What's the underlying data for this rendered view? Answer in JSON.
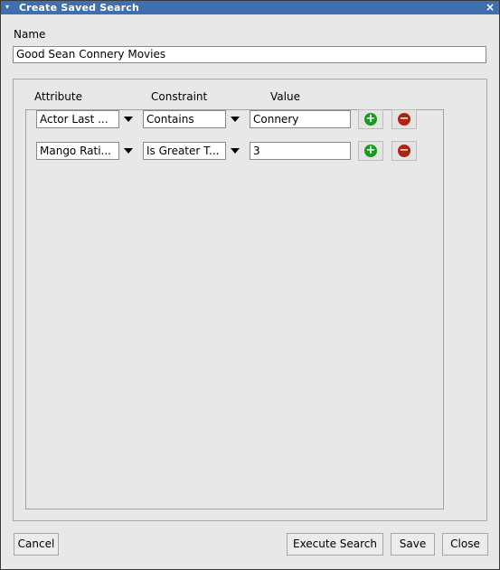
{
  "window": {
    "title": "Create Saved Search",
    "close_glyph": "×",
    "menu_glyph": "▾"
  },
  "name": {
    "label": "Name",
    "value": "Good Sean Connery Movies"
  },
  "criteria": {
    "headers": {
      "attribute": "Attribute",
      "constraint": "Constraint",
      "value": "Value"
    },
    "rows": [
      {
        "attribute": "Actor Last ...",
        "constraint": "Contains",
        "value": "Connery"
      },
      {
        "attribute": "Mango Rati...",
        "constraint": "Is Greater T...",
        "value": "3"
      }
    ],
    "add_glyph": "+",
    "remove_glyph": "−"
  },
  "buttons": {
    "cancel": "Cancel",
    "execute": "Execute Search",
    "save": "Save",
    "close": "Close"
  },
  "icons": {
    "add": "plus-circle-green-icon",
    "remove": "minus-circle-red-icon",
    "dropdown": "triangle-down-icon"
  },
  "colors": {
    "titlebar": "#3f6fae",
    "add": "#1a9a20",
    "remove": "#b4220f"
  }
}
